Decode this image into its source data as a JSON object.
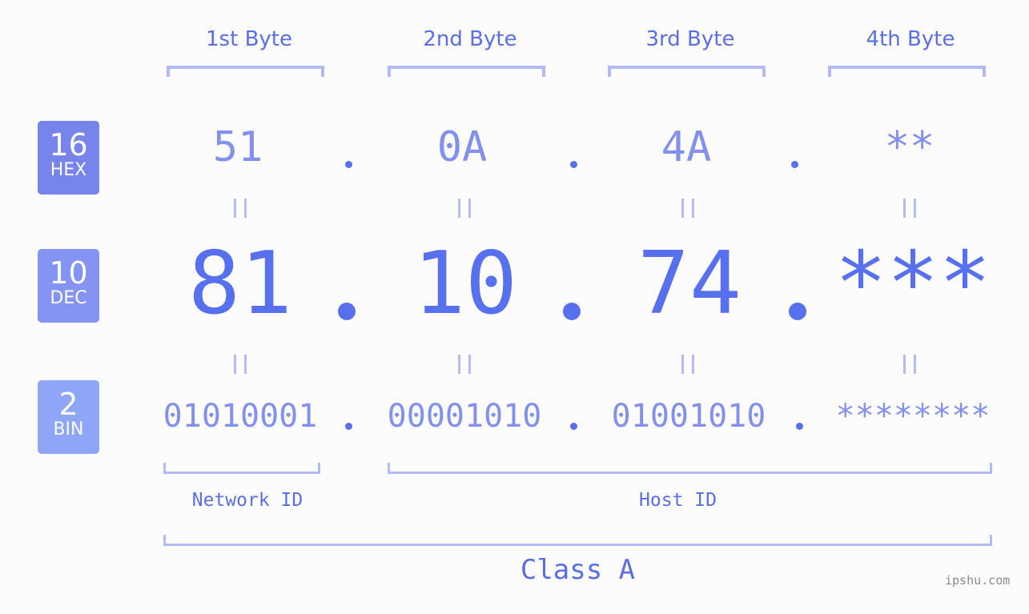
{
  "colors": {
    "accent": "#5670ee",
    "muted": "#8290ee",
    "bracket": "#b3bbf6",
    "label": "#5a6ee6",
    "hex_badge": "#7684ec",
    "dec_badge": "#8494f3",
    "bin_badge": "#8fa6f8",
    "background": "#fbfcfb"
  },
  "byte_headers": [
    "1st Byte",
    "2nd Byte",
    "3rd Byte",
    "4th Byte"
  ],
  "badges": {
    "hex": {
      "number": "16",
      "label": "HEX"
    },
    "dec": {
      "number": "10",
      "label": "DEC"
    },
    "bin": {
      "number": "2",
      "label": "BIN"
    }
  },
  "hex_values": [
    "51",
    "0A",
    "4A",
    "**"
  ],
  "dec_values": [
    "81",
    "10",
    "74",
    "***"
  ],
  "bin_values": [
    "01010001",
    "00001010",
    "01001010",
    "********"
  ],
  "separator": ".",
  "equals_sign": "=",
  "segments": {
    "network_id": "Network ID",
    "host_id": "Host ID"
  },
  "class_label": "Class A",
  "watermark": "ipshu.com"
}
